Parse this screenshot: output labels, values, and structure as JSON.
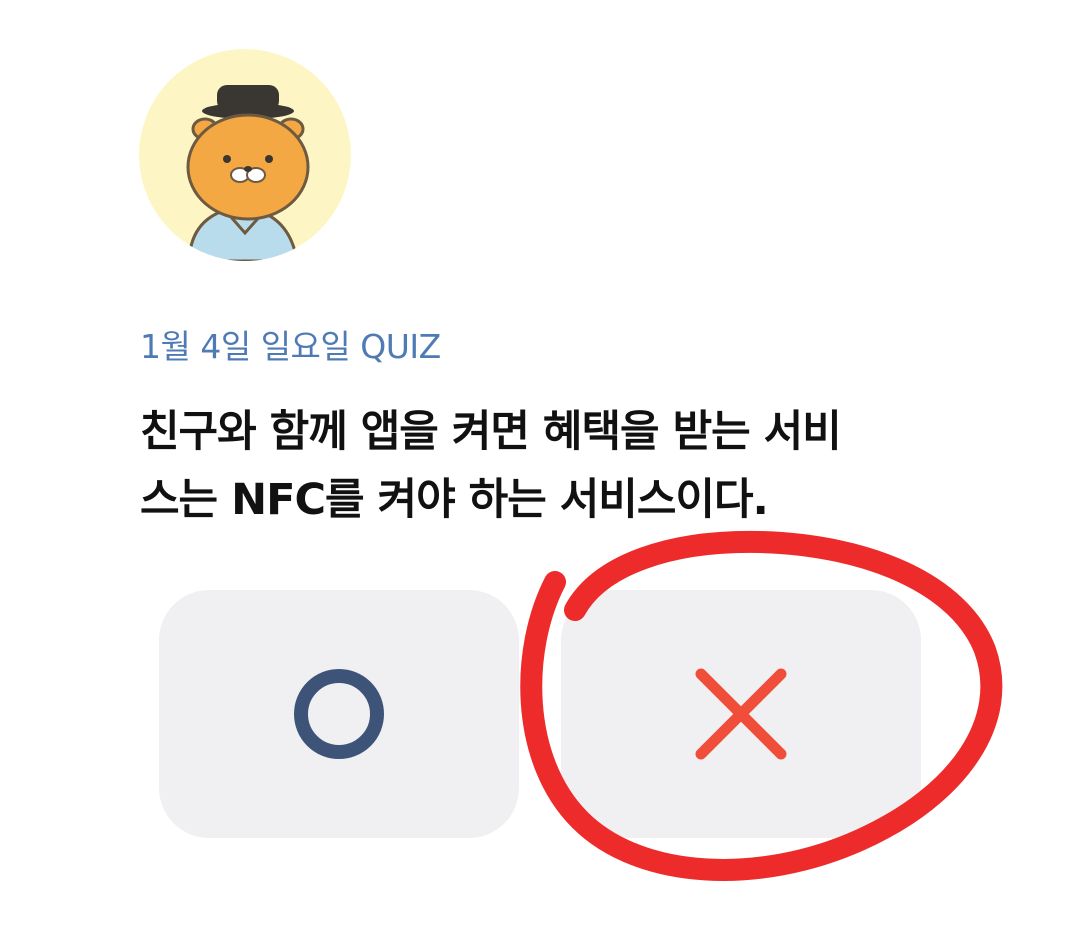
{
  "quiz": {
    "date_label": "1월 4일 일요일 QUIZ",
    "question_line1": "친구와 함께 앱을 켜면 혜택을 받는 서비",
    "question_line2": "스는 NFC를 켜야 하는 서비스이다."
  },
  "answers": {
    "o_icon": "circle-o-icon",
    "x_icon": "x-mark-icon"
  },
  "colors": {
    "date_text": "#4f7bb5",
    "question_text": "#111111",
    "button_bg": "#f0f0f2",
    "o_color": "#3d5478",
    "x_color": "#f04e3a",
    "annotation_red": "#ee2b2b",
    "avatar_bg": "#fdf6c4"
  }
}
